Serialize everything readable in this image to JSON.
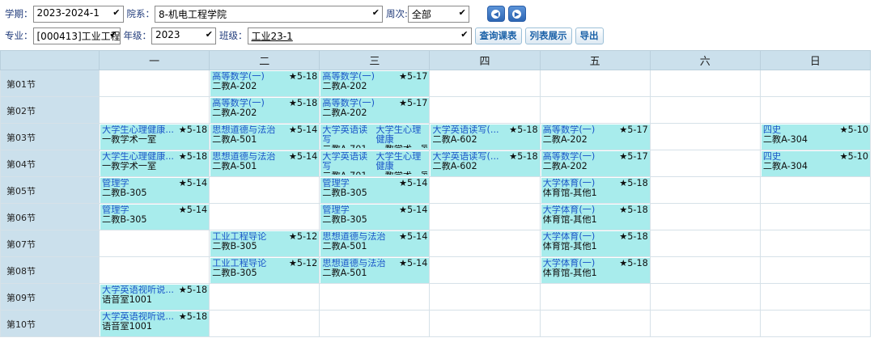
{
  "filters": {
    "term_label": "学期：",
    "term_value": "2023-2024-1",
    "dept_label": "院系：",
    "dept_value": "8-机电工程学院",
    "week_label": "周次:",
    "week_value": "全部",
    "major_label": "专业：",
    "major_value": "[000413]工业工程",
    "grade_label": "年级：",
    "grade_value": "2023",
    "class_label": "班级：",
    "class_value": "工业23-1",
    "query_label": "查询课表",
    "list_label": "列表展示",
    "export_label": "导出"
  },
  "days": [
    "一",
    "二",
    "三",
    "四",
    "五",
    "六",
    "日"
  ],
  "periods": [
    "第01节",
    "第02节",
    "第03节",
    "第04节",
    "第05节",
    "第06节",
    "第07节",
    "第08节",
    "第09节",
    "第10节"
  ],
  "cells": [
    [
      null,
      {
        "name": "高等数学(一)",
        "weeks": "★5-18",
        "room": "二教A-202"
      },
      {
        "name": "高等数学(一)",
        "weeks": "★5-17",
        "room": "二教A-202"
      },
      null,
      null,
      null,
      null
    ],
    [
      null,
      {
        "name": "高等数学(一)",
        "weeks": "★5-18",
        "room": "二教A-202"
      },
      {
        "name": "高等数学(一)",
        "weeks": "★5-17",
        "room": "二教A-202"
      },
      null,
      null,
      null,
      null
    ],
    [
      {
        "name": "大学生心理健康...",
        "weeks": "★5-18",
        "room": "一教学术一室"
      },
      {
        "name": "思想道德与法治",
        "weeks": "★5-14",
        "room": "二教A-501"
      },
      {
        "split": [
          {
            "name": "大学英语读写",
            "room": "二教A-701"
          },
          {
            "name": "大学生心理健康",
            "room": "一教学术一室"
          }
        ]
      },
      {
        "name": "大学英语读写(...",
        "weeks": "★5-18",
        "room": "二教A-602"
      },
      {
        "name": "高等数学(一)",
        "weeks": "★5-17",
        "room": "二教A-202"
      },
      null,
      {
        "name": "四史",
        "weeks": "★5-10",
        "room": "二教A-304"
      }
    ],
    [
      {
        "name": "大学生心理健康...",
        "weeks": "★5-18",
        "room": "一教学术一室"
      },
      {
        "name": "思想道德与法治",
        "weeks": "★5-14",
        "room": "二教A-501"
      },
      {
        "split": [
          {
            "name": "大学英语读写",
            "room": "二教A-701"
          },
          {
            "name": "大学生心理健康",
            "room": "一教学术一室"
          }
        ]
      },
      {
        "name": "大学英语读写(...",
        "weeks": "★5-18",
        "room": "二教A-602"
      },
      {
        "name": "高等数学(一)",
        "weeks": "★5-17",
        "room": "二教A-202"
      },
      null,
      {
        "name": "四史",
        "weeks": "★5-10",
        "room": "二教A-304"
      }
    ],
    [
      {
        "name": "管理学",
        "weeks": "★5-14",
        "room": "二教B-305"
      },
      null,
      {
        "name": "管理学",
        "weeks": "★5-14",
        "room": "二教B-305"
      },
      null,
      {
        "name": "大学体育(一)",
        "weeks": "★5-18",
        "room": "体育馆-其他1"
      },
      null,
      null
    ],
    [
      {
        "name": "管理学",
        "weeks": "★5-14",
        "room": "二教B-305"
      },
      null,
      {
        "name": "管理学",
        "weeks": "★5-14",
        "room": "二教B-305"
      },
      null,
      {
        "name": "大学体育(一)",
        "weeks": "★5-18",
        "room": "体育馆-其他1"
      },
      null,
      null
    ],
    [
      null,
      {
        "name": "工业工程导论",
        "weeks": "★5-12",
        "room": "二教B-305"
      },
      {
        "name": "思想道德与法治",
        "weeks": "★5-14",
        "room": "二教A-501"
      },
      null,
      {
        "name": "大学体育(一)",
        "weeks": "★5-18",
        "room": "体育馆-其他1"
      },
      null,
      null
    ],
    [
      null,
      {
        "name": "工业工程导论",
        "weeks": "★5-12",
        "room": "二教B-305"
      },
      {
        "name": "思想道德与法治",
        "weeks": "★5-14",
        "room": "二教A-501"
      },
      null,
      {
        "name": "大学体育(一)",
        "weeks": "★5-18",
        "room": "体育馆-其他1"
      },
      null,
      null
    ],
    [
      {
        "name": "大学英语视听说...",
        "weeks": "★5-18",
        "room": "语音室1001"
      },
      null,
      null,
      null,
      null,
      null,
      null
    ],
    [
      {
        "name": "大学英语视听说...",
        "weeks": "★5-18",
        "room": "语音室1001"
      },
      null,
      null,
      null,
      null,
      null,
      null
    ]
  ]
}
